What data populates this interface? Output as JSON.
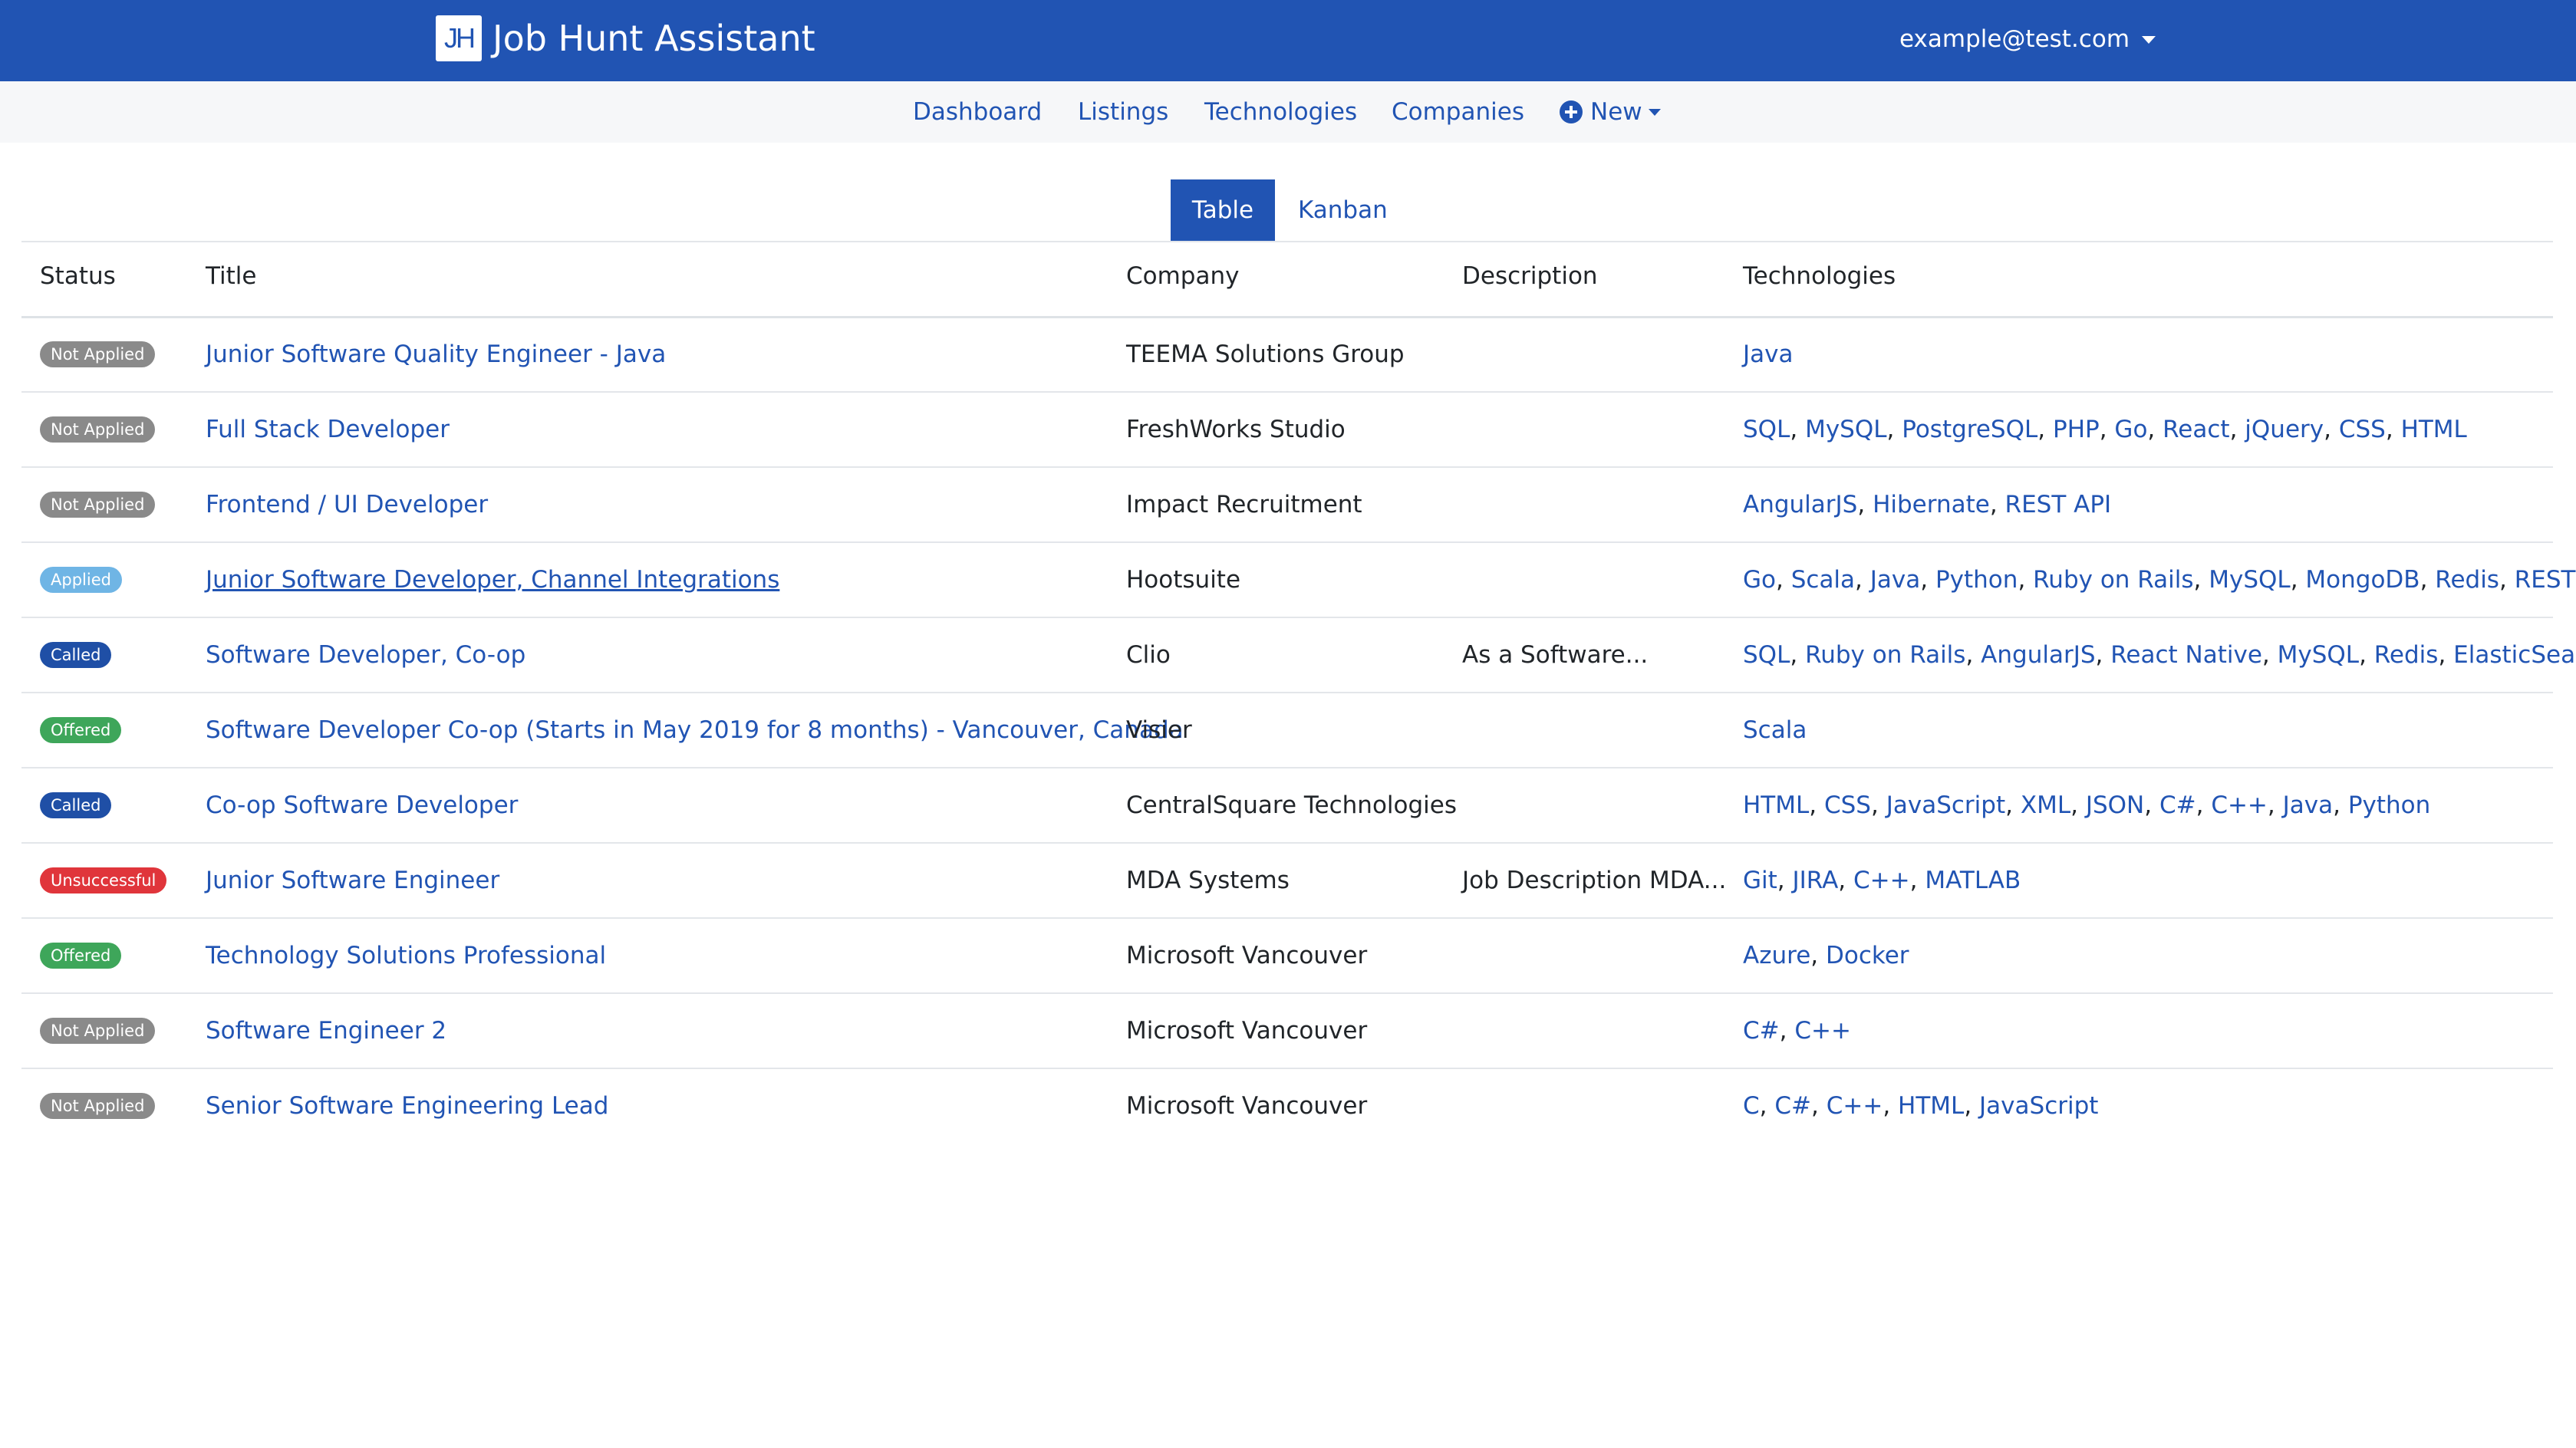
{
  "app": {
    "logo_text": "JH",
    "name": "Job Hunt Assistant",
    "user_email": "example@test.com"
  },
  "nav": {
    "dashboard": "Dashboard",
    "listings": "Listings",
    "technologies": "Technologies",
    "companies": "Companies",
    "new": "New"
  },
  "view_toggle": {
    "table": "Table",
    "kanban": "Kanban",
    "active": "Table"
  },
  "table": {
    "headers": {
      "status": "Status",
      "title": "Title",
      "company": "Company",
      "description": "Description",
      "technologies": "Technologies"
    },
    "rows": [
      {
        "status": "Not Applied",
        "title": "Junior Software Quality Engineer - Java",
        "company": "TEEMA Solutions Group",
        "description": "",
        "technologies": [
          "Java"
        ]
      },
      {
        "status": "Not Applied",
        "title": "Full Stack Developer",
        "company": "FreshWorks Studio",
        "description": "",
        "technologies": [
          "SQL",
          "MySQL",
          "PostgreSQL",
          "PHP",
          "Go",
          "React",
          "jQuery",
          "CSS",
          "HTML"
        ]
      },
      {
        "status": "Not Applied",
        "title": "Frontend / UI Developer",
        "company": "Impact Recruitment",
        "description": "",
        "technologies": [
          "AngularJS",
          "Hibernate",
          "REST API"
        ]
      },
      {
        "status": "Applied",
        "title": "Junior Software Developer, Channel Integrations",
        "company": "Hootsuite",
        "description": "",
        "technologies": [
          "Go",
          "Scala",
          "Java",
          "Python",
          "Ruby on Rails",
          "MySQL",
          "MongoDB",
          "Redis",
          "REST API"
        ]
      },
      {
        "status": "Called",
        "title": "Software Developer, Co-op",
        "company": "Clio",
        "description": "As a Software...",
        "technologies": [
          "SQL",
          "Ruby on Rails",
          "AngularJS",
          "React Native",
          "MySQL",
          "Redis",
          "ElasticSearch"
        ]
      },
      {
        "status": "Offered",
        "title": "Software Developer Co-op (Starts in May 2019 for 8 months) - Vancouver, Canada",
        "company": "Visier",
        "description": "",
        "technologies": [
          "Scala"
        ]
      },
      {
        "status": "Called",
        "title": "Co-op Software Developer",
        "company": "CentralSquare Technologies",
        "description": "",
        "technologies": [
          "HTML",
          "CSS",
          "JavaScript",
          "XML",
          "JSON",
          "C#",
          "C++",
          "Java",
          "Python"
        ]
      },
      {
        "status": "Unsuccessful",
        "title": "Junior Software Engineer",
        "company": "MDA Systems",
        "description": "Job Description MDA...",
        "technologies": [
          "Git",
          "JIRA",
          "C++",
          "MATLAB"
        ]
      },
      {
        "status": "Offered",
        "title": "Technology Solutions Professional",
        "company": "Microsoft Vancouver",
        "description": "",
        "technologies": [
          "Azure",
          "Docker"
        ]
      },
      {
        "status": "Not Applied",
        "title": "Software Engineer 2",
        "company": "Microsoft Vancouver",
        "description": "",
        "technologies": [
          "C#",
          "C++"
        ]
      },
      {
        "status": "Not Applied",
        "title": "Senior Software Engineering Lead",
        "company": "Microsoft Vancouver",
        "description": "",
        "technologies": [
          "C",
          "C#",
          "C++",
          "HTML",
          "JavaScript"
        ]
      }
    ]
  },
  "colors": {
    "primary": "#2154b3",
    "not_applied": "#8a8a8a",
    "applied": "#6fb5e5",
    "called": "#1f4fa6",
    "offered": "#3ea65a",
    "unsuccessful": "#e0353b"
  }
}
